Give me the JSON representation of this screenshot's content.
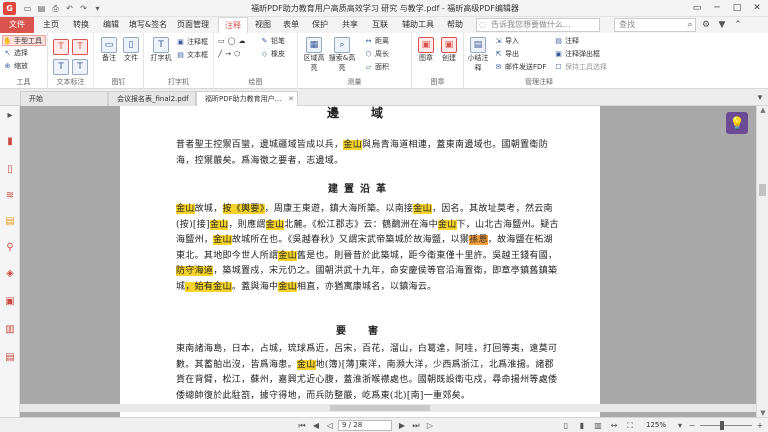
{
  "titlebar": {
    "title": "福昕PDF助力教育用户高质高效学习 研究 与教学.pdf - 福昕高级PDF编辑器",
    "search_placeholder": "告诉我您想要做什么..."
  },
  "ribbon_tabs": [
    "文件",
    "主页",
    "转换",
    "编辑",
    "填写&签名",
    "页面管理",
    "注释",
    "视图",
    "表单",
    "保护",
    "共享",
    "互联",
    "辅助工具",
    "帮助"
  ],
  "active_tab": "注释",
  "find_placeholder": "查找",
  "ribbon": {
    "tools": {
      "items": [
        "手型工具",
        "选择",
        "缩放"
      ],
      "label": "工具"
    },
    "text_markup": {
      "label": "文本标注"
    },
    "pin": {
      "items": [
        "备注",
        "文件"
      ],
      "label": "图钉"
    },
    "typewriter": {
      "items": [
        "打字机",
        "注释框",
        "文本框"
      ],
      "label": "打字机"
    },
    "drawing": {
      "items": [
        "铅笔",
        "橡皮"
      ],
      "label": "绘图"
    },
    "measure": {
      "items": [
        "区域高亮",
        "搜索&高亮",
        "距离",
        "周长",
        "面积"
      ],
      "label": "测量"
    },
    "stamp": {
      "items": [
        "图章",
        "创建"
      ],
      "label": "图章"
    },
    "manage": {
      "items": [
        "小结注释",
        "导入",
        "导出",
        "邮件发送FDF",
        "注释",
        "注释弹出框",
        "保持工具选择"
      ],
      "label": "管理注释"
    }
  },
  "doc_tabs": [
    "开始",
    "会议报名表_final2.pdf",
    "福昕PDF助力教育用户..."
  ],
  "document": {
    "title": "邊　域",
    "p1": [
      "昔者聖王控禦百蠻，邊城疆域皆成以兵，",
      "金山",
      "與烏青海道相連，蓋東南邊域也。國朝置衛防海，控禦嚴矣。爲海徼之要者，志邊域。"
    ],
    "section1": "建置沿革",
    "p2a": [
      "金山",
      "故城，",
      "按《輿要》",
      "，周康王東遊，鎮大海所築。以南接",
      "金山",
      "，因名。其故址莫考，然云南(按)[接]",
      "金山",
      "，則應謂",
      "金山",
      "北麓。《松江郡志》云：鶴鷸洲在海中",
      "金山",
      "下，山北古海鹽州。疑古海鹽州，",
      "金山",
      "故城所在也。《吳越春秋》又謂宋武帝築城於故海鹽，以",
      "禦",
      "孫恩",
      "，故海鹽在柘湖東北。其地即今世人所謂",
      "金山",
      "舊是也。則晉昔於此築城，距今衛東僅十里許。吳越王錢有國，",
      "防守海道",
      "，築城置戍，宋元仍之。國朝洪武十九年，命安慶侯等官沿海置衛，即章亭鎮舊鎮築城",
      "，始有金山",
      "。蓋與海中",
      "金山",
      "相直，亦猶寓康城名，以鎮海云。"
    ],
    "section2": "要　害",
    "p3": [
      "東南諸海島，日本，占城，琉球爲近，呂宋，百花，溜山，白葛達，阿哇，打回等夷，遠莫可數。其蓄舶出沒，皆爲海患。",
      "金山",
      "地(簿)[薄]東洋，南瀕大洋，少西爲浙江，北爲淮揚。諸郡貨在背臂，松江，蘇州，嘉興尤近心腹，蓋淮浙喉襟處也。國朝既設衛屯戍，尋命揚州等處倭倭總帥復於此駐箚，據守得地，而兵防整嚴，屹爲東(北)[南]一重郊矣。"
    ]
  },
  "statusbar": {
    "page": "9 / 28",
    "zoom": "125%"
  }
}
